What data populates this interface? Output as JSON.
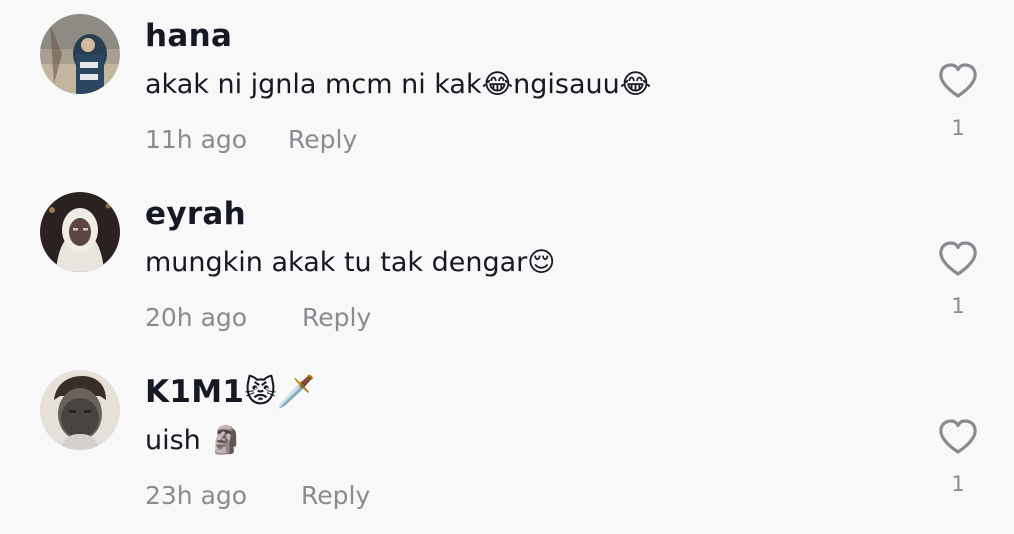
{
  "comments": [
    {
      "username": "hana",
      "text": "akak ni jgnla mcm ni kak😂ngisauu😂",
      "time": "11h ago",
      "reply_label": "Reply",
      "likes": "1",
      "avatar_icon": "profile-photo-hana"
    },
    {
      "username": "eyrah",
      "text": "mungkin akak tu tak dengar😌",
      "time": "20h ago",
      "reply_label": "Reply",
      "likes": "1",
      "avatar_icon": "profile-photo-eyrah"
    },
    {
      "username": "K1M1😾🗡️",
      "text": "uish 🗿",
      "time": "23h ago",
      "reply_label": "Reply",
      "likes": "1",
      "avatar_icon": "profile-photo-k1m1"
    }
  ],
  "colors": {
    "background": "#f8f8f8",
    "primary_text": "#161823",
    "secondary_text": "#8a8b91"
  },
  "icons": {
    "like": "heart-outline-icon"
  }
}
